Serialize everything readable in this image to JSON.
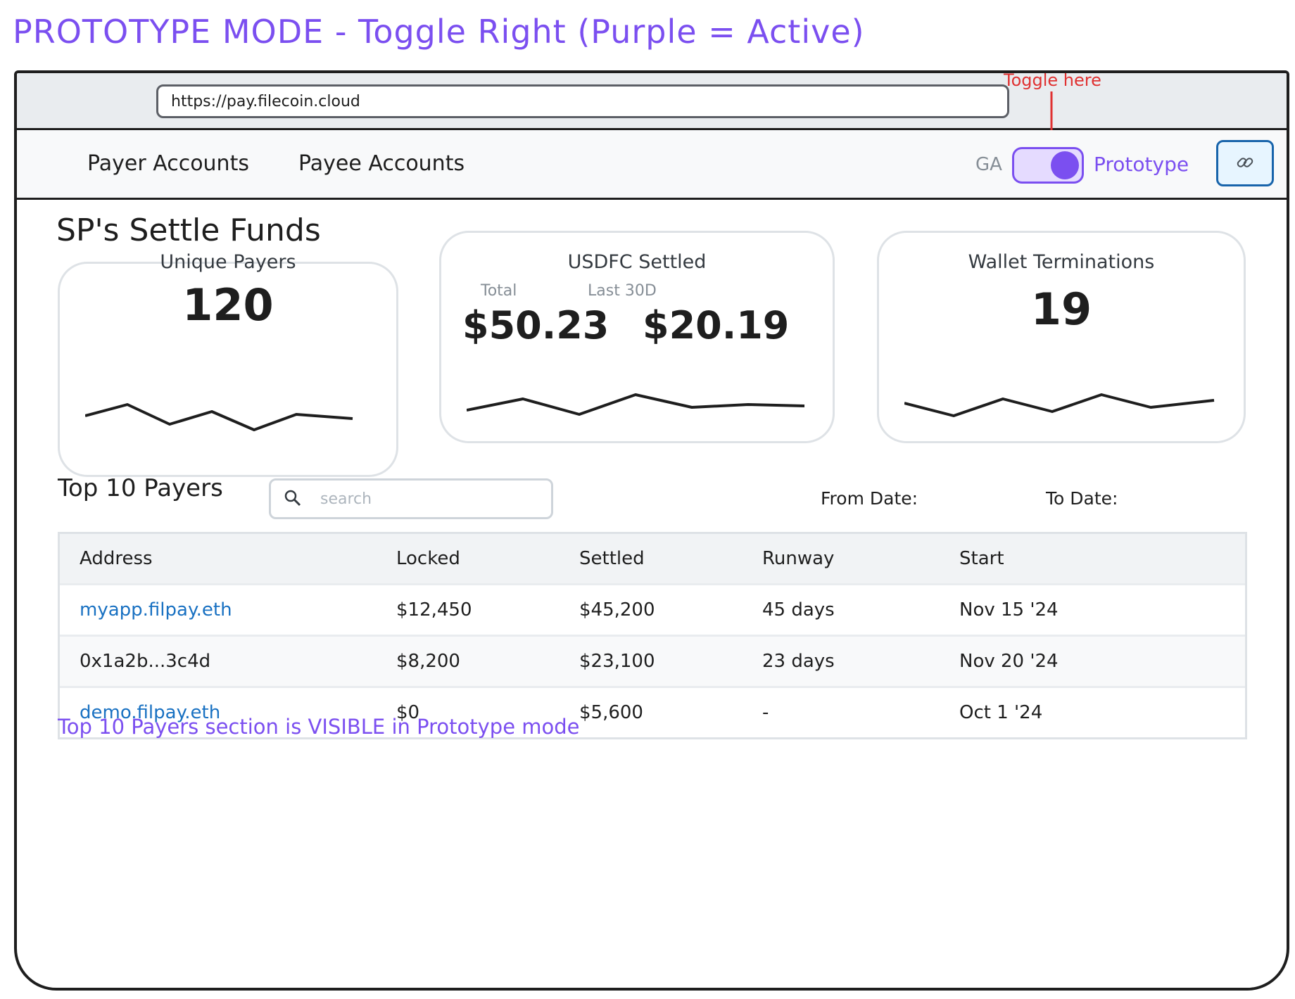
{
  "banner": "PROTOTYPE MODE - Toggle Right (Purple = Active)",
  "browser": {
    "url": "https://pay.filecoin.cloud"
  },
  "annotation": {
    "toggle_note": "Toggle here"
  },
  "nav": {
    "items": [
      {
        "label": "Payer Accounts"
      },
      {
        "label": "Payee Accounts"
      }
    ],
    "mode_left": "GA",
    "mode_right": "Prototype",
    "toggle_state": "prototype",
    "share_icon": "link-icon"
  },
  "page": {
    "title": "SP's Settle Funds"
  },
  "cards": {
    "unique_payers": {
      "title": "Unique Payers",
      "value": "120"
    },
    "usdfc_settled": {
      "title": "USDFC Settled",
      "total_label": "Total",
      "last30_label": "Last 30D",
      "total_value": "$50.23",
      "last30_value": "$20.19"
    },
    "wallet_terminations": {
      "title": "Wallet Terminations",
      "value": "19"
    }
  },
  "top_payers": {
    "title": "Top 10 Payers",
    "search_placeholder": "search",
    "from_date_label": "From Date:",
    "to_date_label": "To Date:",
    "columns": [
      "Address",
      "Locked",
      "Settled",
      "Runway",
      "Start"
    ],
    "rows": [
      {
        "address": "myapp.filpay.eth",
        "is_link": true,
        "locked": "$12,450",
        "settled": "$45,200",
        "runway": "45 days",
        "start": "Nov 15 '24"
      },
      {
        "address": "0x1a2b...3c4d",
        "is_link": false,
        "locked": "$8,200",
        "settled": "$23,100",
        "runway": "23 days",
        "start": "Nov 20 '24"
      },
      {
        "address": "demo.filpay.eth",
        "is_link": true,
        "locked": "$0",
        "settled": "$5,600",
        "runway": "-",
        "start": "Oct 1 '24"
      }
    ]
  },
  "footnote": "Top 10 Payers section is VISIBLE in Prototype mode",
  "colors": {
    "accent": "#7b4ff0",
    "annotation": "#e03131",
    "link": "#1971c2"
  }
}
